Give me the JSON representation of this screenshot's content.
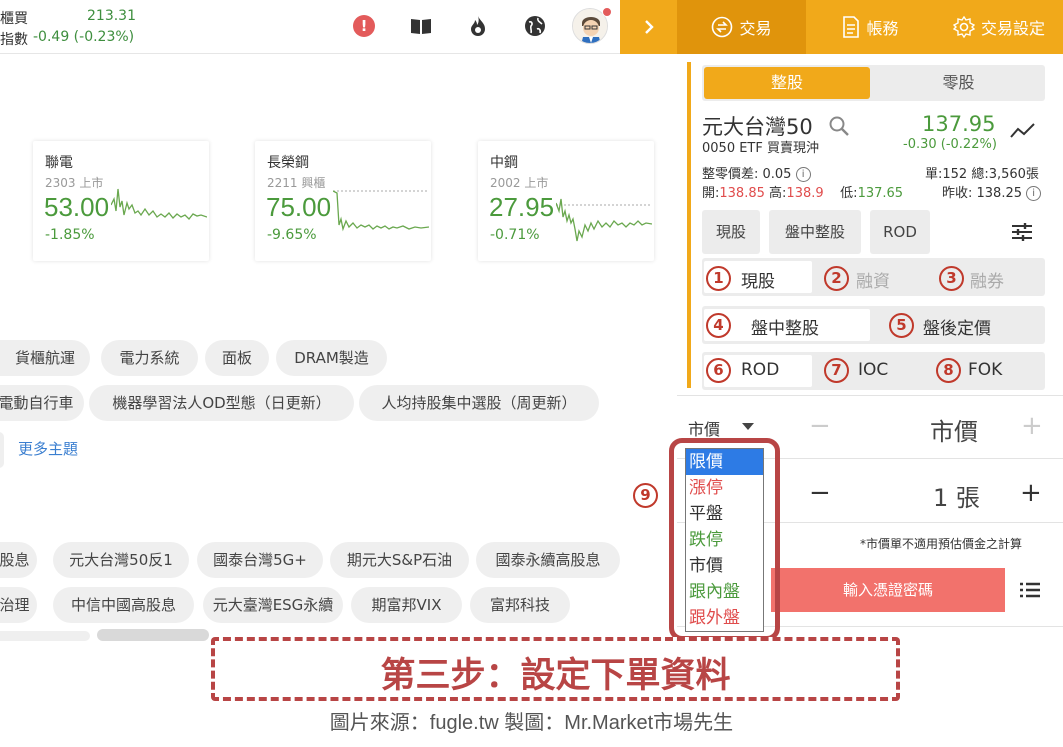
{
  "ticker": {
    "row1_label": "櫃買",
    "row1_value": "213.31",
    "row2_label": "指數",
    "row2_value": "-0.49  (-0.23%)"
  },
  "cards": [
    {
      "name": "聯電",
      "code": "2303 上市",
      "price": "53.00",
      "change": "-1.85%"
    },
    {
      "name": "長榮鋼",
      "code": "2211 興櫃",
      "price": "75.00",
      "change": "-9.65%"
    },
    {
      "name": "中鋼",
      "code": "2002 上市",
      "price": "27.95",
      "change": "-0.71%"
    }
  ],
  "themes": {
    "row1": [
      "貨櫃航運",
      "電力系統",
      "面板",
      "DRAM製造"
    ],
    "row2": [
      "電動自行車",
      "機器學習法人OD型態（日更新）",
      "人均持股集中選股（周更新）"
    ],
    "more": "更多主題"
  },
  "etfs": {
    "row1": [
      "股息",
      "元大台灣50反1",
      "國泰台灣5G+",
      "期元大S&P石油",
      "國泰永續高股息"
    ],
    "row2": [
      "治理",
      "中信中國高股息",
      "元大臺灣ESG永續",
      "期富邦VIX",
      "富邦科技"
    ]
  },
  "tabs": {
    "trade": "交易",
    "account": "帳務",
    "settings": "交易設定"
  },
  "segment": {
    "whole": "整股",
    "odd": "零股"
  },
  "stock": {
    "name": "元大台灣50",
    "sub": "0050 ETF  買賣現沖",
    "price": "137.95",
    "change": "-0.30 (-0.22%)",
    "spread": "整零價差: 0.05",
    "vol": "單:152   總:3,560張",
    "open_label": "開:",
    "open": "138.85",
    "high_label": "高:",
    "high": "138.9",
    "low_label": "低:",
    "low": "137.65",
    "prev": "昨收: 138.25"
  },
  "order_opts": {
    "cash": "現股",
    "intraday": "盤中整股",
    "rod": "ROD"
  },
  "rows": {
    "r1": [
      {
        "n": "1",
        "t": "現股"
      },
      {
        "n": "2",
        "t": "融資"
      },
      {
        "n": "3",
        "t": "融券"
      }
    ],
    "r2": [
      {
        "n": "4",
        "t": "盤中整股"
      },
      {
        "n": "5",
        "t": "盤後定價"
      }
    ],
    "r3": [
      {
        "n": "6",
        "t": "ROD"
      },
      {
        "n": "7",
        "t": "IOC"
      },
      {
        "n": "8",
        "t": "FOK"
      }
    ]
  },
  "form": {
    "price_type": "市價",
    "price_value": "市價",
    "qty_value": "1 張",
    "note": "*市價單不適用預估價金之計算",
    "submit": "輸入憑證密碼",
    "step9": "9"
  },
  "dropdown": [
    "限價",
    "漲停",
    "平盤",
    "跌停",
    "市價",
    "跟內盤",
    "跟外盤"
  ],
  "banner": "第三步：設定下單資料",
  "credit": "圖片來源：fugle.tw  製圖：Mr.Market市場先生"
}
